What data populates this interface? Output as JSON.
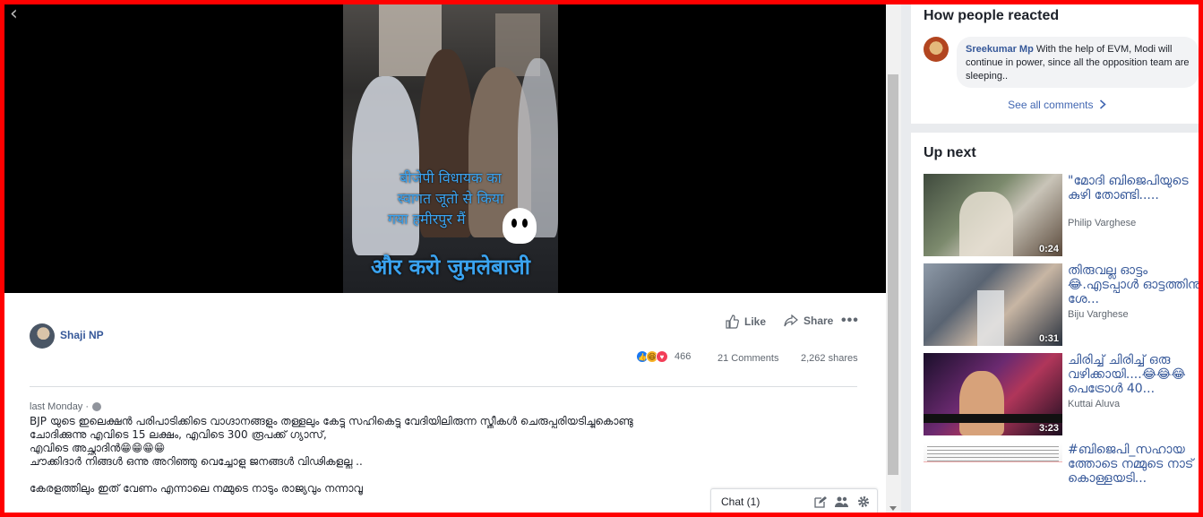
{
  "video": {
    "caption_line1": "बीजेपी विधायक का",
    "caption_line2": "स्वागत जूतो से किया",
    "caption_line3": "गया हमीरपुर मैं",
    "caption_big": "और करो जुमलेबाजी"
  },
  "post": {
    "author": "Shaji NP",
    "like_label": "Like",
    "share_label": "Share",
    "more_label": "•••",
    "reaction_count": "466",
    "comments_count": "21 Comments",
    "shares_count": "2,262 shares",
    "timestamp": "last Monday ·",
    "text_line1": "BJP യുടെ ഇലെക്ഷൻ പരിപാടിക്കിടെ വാഗ്ദാനങ്ങളും തള്ളലും കേട്ടു സഹികെട്ടു വേദിയിലിരുന്ന സ്ത്രീകൾ ചെരുപ്പൂരിയടിച്ചുകൊണ്ടു",
    "text_line2": "ചോദിക്കുന്നു എവിടെ 15 ലക്ഷം, എവിടെ 300 രൂപക്ക് ഗ്യാസ്,",
    "text_line3": "എവിടെ അച്ഛാദിൻ😁😁😁😁",
    "text_line4": "ചൗക്കിദാർ നിങ്ങൾ ഒന്നു അറിഞ്ഞു വെച്ചോളു ജനങ്ങൾ വിഢികളല്ല ..",
    "text_line5": "കേരളത്തിലും ഇത് വേണം എന്നാലെ നമ്മുടെ നാടും രാജ്യവും നന്നാവൂ"
  },
  "chat": {
    "label": "Chat (1)"
  },
  "reactions_panel": {
    "title": "How people reacted",
    "comment_author": "Sreekumar Mp",
    "comment_text": "With the help of EVM, Modi will continue in power, since all the opposition team are sleeping..",
    "see_all": "See all comments"
  },
  "up_next": {
    "title": "Up next",
    "items": [
      {
        "title": "\"മോദി ബിജെപിയുടെ കുഴി തോണ്ടി.....",
        "author": "Philip Varghese",
        "duration": "0:24"
      },
      {
        "title": "തിരുവല്ല ഓട്ടം 😂.എടപ്പാൾ ഓട്ടത്തിനു ശേ...",
        "author": "Biju Varghese",
        "duration": "0:31"
      },
      {
        "title": "ചിരിച്ച് ചിരിച്ച് ഒരു വഴിക്കായി....😂😂😂 പെട്രോൾ 40...",
        "author": "Kuttai Aluva",
        "duration": "3:23"
      },
      {
        "title": "#ബിജെപി_സഹായത്തോടെ നമ്മുടെ നാട് കൊള്ളയടി...",
        "author": "",
        "duration": ""
      }
    ]
  },
  "colors": {
    "frame": "#ff0000",
    "link": "#365899",
    "accent": "#1877f2"
  }
}
